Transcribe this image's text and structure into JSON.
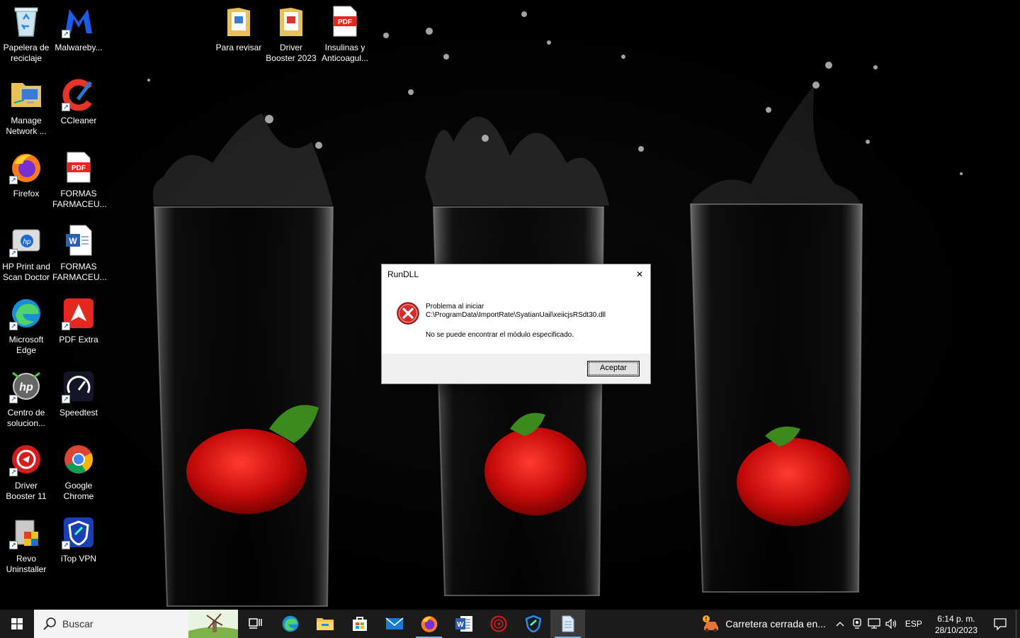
{
  "desktop": {
    "icons": [
      {
        "label": "Papelera de\nreciclaje",
        "icon": "recycle-bin-icon"
      },
      {
        "label": "Malwareby...",
        "icon": "malwarebytes-icon"
      },
      {
        "label": "Manage\nNetwork ...",
        "icon": "network-folder-icon"
      },
      {
        "label": "CCleaner",
        "icon": "ccleaner-icon"
      },
      {
        "label": "Firefox",
        "icon": "firefox-icon"
      },
      {
        "label": "FORMAS\nFARMACEU...",
        "icon": "pdf-file-icon"
      },
      {
        "label": "HP Print and\nScan Doctor",
        "icon": "hp-doctor-icon"
      },
      {
        "label": "FORMAS\nFARMACEU...",
        "icon": "word-file-icon"
      },
      {
        "label": "Microsoft\nEdge",
        "icon": "edge-icon"
      },
      {
        "label": "PDF Extra",
        "icon": "pdf-extra-icon"
      },
      {
        "label": "Centro de\nsolucion...",
        "icon": "hp-solution-center-icon"
      },
      {
        "label": "Speedtest",
        "icon": "speedtest-icon"
      },
      {
        "label": "Driver\nBooster 11",
        "icon": "driver-booster-icon"
      },
      {
        "label": "Google\nChrome",
        "icon": "chrome-icon"
      },
      {
        "label": "Revo\nUninstaller",
        "icon": "revo-uninstaller-icon"
      },
      {
        "label": "iTop VPN",
        "icon": "itop-vpn-icon"
      },
      {
        "label": "Para revisar",
        "icon": "folder-icon"
      },
      {
        "label": "Driver\nBooster 2023",
        "icon": "folder-icon"
      },
      {
        "label": "Insulinas y\nAnticoagul...",
        "icon": "pdf-file-icon"
      }
    ]
  },
  "dialog": {
    "title": "RunDLL",
    "close": "✕",
    "message_line1": "Problema al iniciar\nC:\\ProgramData\\ImportRate\\SyatianUail\\xeiicjsRSdt30.dll",
    "message_line2": "No se puede encontrar el módulo especificado.",
    "ok_button": "Aceptar",
    "icon": "error-icon"
  },
  "taskbar": {
    "search_placeholder": "Buscar",
    "apps": [
      "task-view-icon",
      "edge-icon",
      "file-explorer-icon",
      "store-icon",
      "mail-icon",
      "firefox-icon",
      "word-icon",
      "driver-booster-icon",
      "itop-vpn-icon",
      "notepad-icon"
    ],
    "news_text": "Carretera cerrada en...",
    "language": "ESP",
    "time": "6:14 p. m.",
    "date": "28/10/2023"
  }
}
